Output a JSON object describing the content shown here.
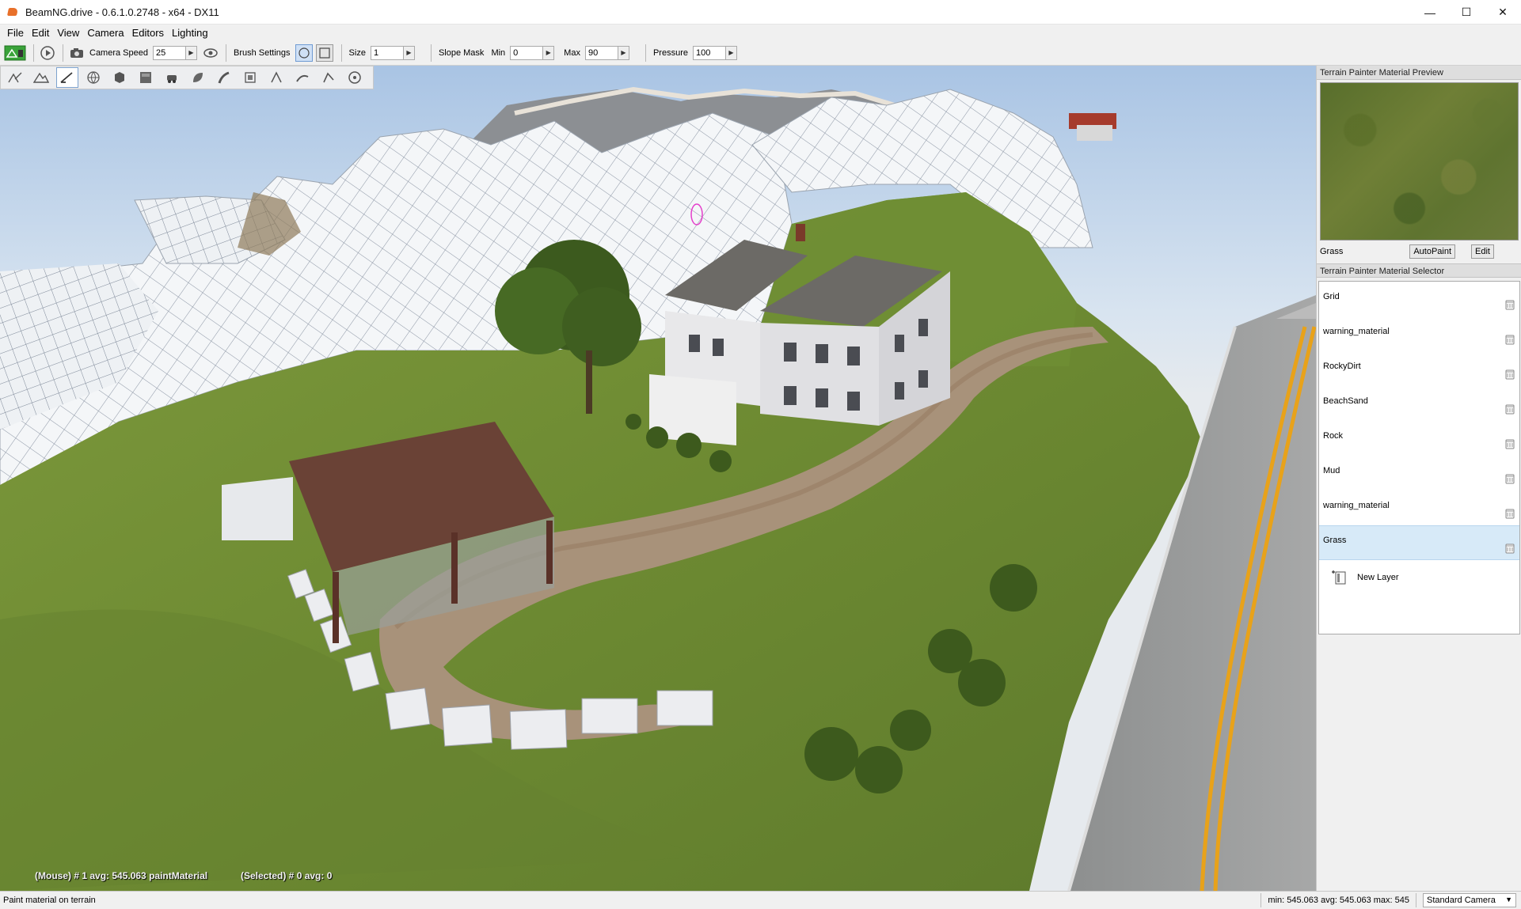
{
  "window": {
    "title": "BeamNG.drive - 0.6.1.0.2748 - x64 - DX11",
    "controls": {
      "minimize": "—",
      "maximize": "☐",
      "close": "✕"
    }
  },
  "menu": [
    "File",
    "Edit",
    "View",
    "Camera",
    "Editors",
    "Lighting"
  ],
  "toolbar": {
    "camera_speed_label": "Camera Speed",
    "camera_speed_value": "25",
    "brush_settings_label": "Brush Settings",
    "size_label": "Size",
    "size_value": "1",
    "slope_mask_label": "Slope Mask",
    "min_label": "Min",
    "min_value": "0",
    "max_label": "Max",
    "max_value": "90",
    "pressure_label": "Pressure",
    "pressure_value": "100"
  },
  "viewport": {
    "mouse_info": "(Mouse) # 1  avg: 545.063 paintMaterial",
    "selected_info": "(Selected) # 0  avg: 0"
  },
  "preview_panel": {
    "header": "Terrain Painter Material Preview",
    "material_name": "Grass",
    "autopaint_label": "AutoPaint",
    "edit_label": "Edit"
  },
  "selector_panel": {
    "header": "Terrain Painter Material Selector",
    "materials": [
      {
        "label": "Grid"
      },
      {
        "label": "warning_material"
      },
      {
        "label": "RockyDirt"
      },
      {
        "label": "BeachSand"
      },
      {
        "label": "Rock"
      },
      {
        "label": "Mud"
      },
      {
        "label": "warning_material"
      },
      {
        "label": "Grass"
      }
    ],
    "selected_material": "Grass",
    "new_layer_label": "New Layer"
  },
  "status": {
    "message": "Paint material on terrain",
    "stats": "min: 545.063  avg: 545.063  max: 545",
    "camera_mode": "Standard Camera"
  },
  "colors": {
    "accent_selected": "#d7eaf8",
    "grass": "#6b8a34",
    "road_line": "#e8a21a"
  }
}
